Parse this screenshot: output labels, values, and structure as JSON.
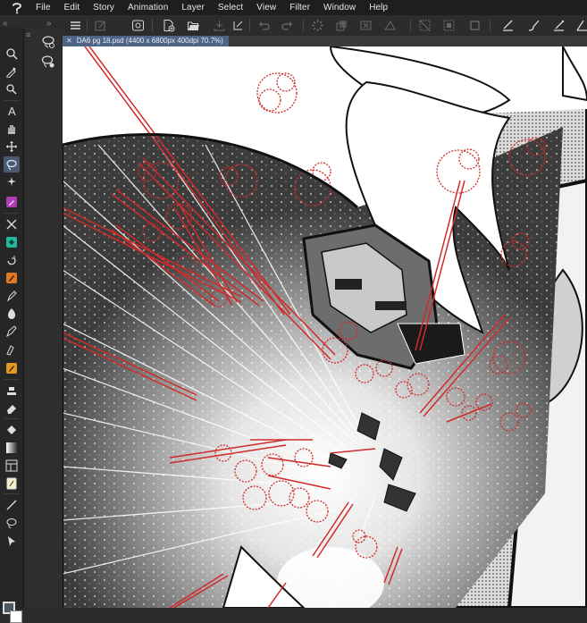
{
  "menubar": {
    "items": [
      "File",
      "Edit",
      "Story",
      "Animation",
      "Layer",
      "Select",
      "View",
      "Filter",
      "Window",
      "Help"
    ]
  },
  "document": {
    "tab_label": "DA6 pg 18.psd (4400 x 6800px 400dpi 70.7%)"
  },
  "command_bar": {
    "icons": [
      "menu-icon",
      "new-icon",
      "open-icon",
      "save-icon",
      "undo-icon",
      "redo-icon",
      "fill-icon",
      "clear-icon",
      "transform-icon",
      "deselect-icon",
      "invert-icon",
      "crop-icon"
    ]
  },
  "toolbar": {
    "tools": [
      "zoom-icon",
      "eyedropper-icon",
      "magnifier-icon",
      "text-icon",
      "hand-icon",
      "move-icon",
      "lasso-selection-icon",
      "auto-select-icon",
      "pen-icon",
      "blend-icon",
      "fill-bucket-icon",
      "rotate-icon",
      "brush-icon",
      "marker-icon",
      "pen-tool-icon",
      "pencil-icon",
      "airbrush-icon",
      "stamp-icon",
      "eraser-icon",
      "paint-bucket-icon",
      "gradient-icon",
      "frame-icon",
      "ruler-icon",
      "line-icon",
      "lasso-icon",
      "pointer-icon"
    ]
  },
  "colors": {
    "main_color": "#4a5a60",
    "sub_color": "#ffffff",
    "accent": "#4f6585",
    "selection_red": "#d12a2a"
  }
}
